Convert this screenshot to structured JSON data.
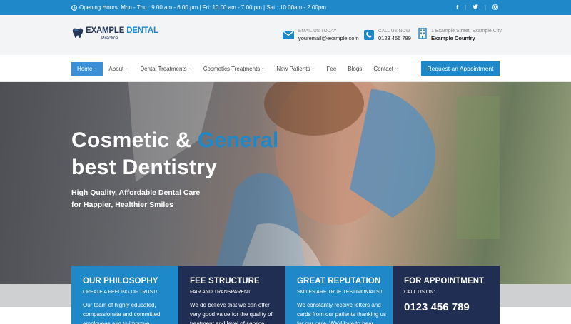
{
  "topbar": {
    "hours": "Opening Hours: Mon - Thu : 9.00 am - 6.00 pm | Fri: 10.00 am - 7.00 pm | Sat : 10.00am - 2.00pm",
    "social": [
      "f",
      "|",
      "y",
      "|",
      "◎"
    ]
  },
  "logo": {
    "main_dark": "EXAMPLE",
    "main_accent": "DENTAL",
    "sub": "Practice"
  },
  "contacts": [
    {
      "label": "EMAIL US TODAY",
      "value": "youremail@example.com",
      "icon": "envelope-icon"
    },
    {
      "label": "CALL US NOW",
      "value": "0123 456 789",
      "icon": "phone-icon"
    },
    {
      "label": "1 Example Street, Example City",
      "value": "Example Country",
      "icon": "building-icon"
    }
  ],
  "nav": {
    "items": [
      "Home",
      "About",
      "Dental Treatments",
      "Cosmetics Treatments",
      "New Patients",
      "Fee",
      "Blogs",
      "Contact"
    ],
    "cta": "Request an Appointment"
  },
  "hero": {
    "title_a": "Cosmetic &",
    "title_b": "General",
    "title_c": "best Dentistry",
    "sub1": "High Quality, Affordable Dental Care",
    "sub2": "for Happier, Healthier Smiles"
  },
  "cards": [
    {
      "title": "OUR PHILOSOPHY",
      "tag": "CREATE A FEELING OF TRUST!!",
      "text": "Our team of highly educated, compassionate and committed employees aim to improve"
    },
    {
      "title": "FEE STRUCTURE",
      "tag": "FAIR AND TRANSPARENT",
      "text": "We do believe that we can offer very good value for the quality of treatment and level of service"
    },
    {
      "title": "GREAT REPUTATION",
      "tag": "SMILES ARE TRUE TESTIMONIALS!!",
      "text": "We constantly receive letters and cards from our patients thanking us for our care. We'd love to hear"
    },
    {
      "title": "FOR APPOINTMENT",
      "tag": "CALL US ON:",
      "phone": "0123 456 789"
    }
  ]
}
